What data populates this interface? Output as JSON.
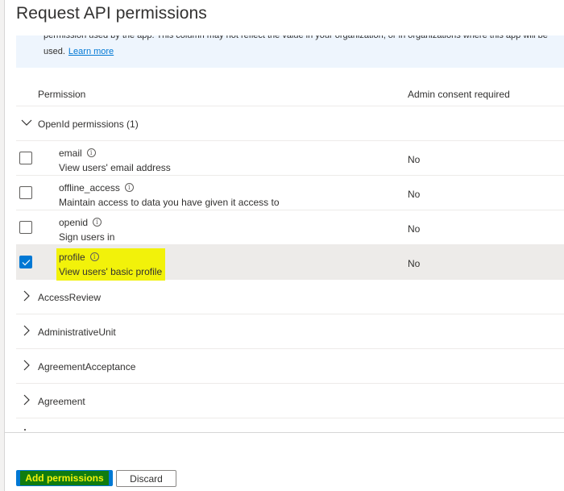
{
  "panel": {
    "title": "Request API permissions"
  },
  "info_banner": {
    "line1": "permission used by the app. This column may not reflect the value in your organization, or in organizations where this app will be",
    "line2": "used.",
    "link": "Learn more"
  },
  "table": {
    "headers": {
      "permission": "Permission",
      "admin_consent": "Admin consent required"
    },
    "expanded_group": {
      "label": "OpenId permissions (1)",
      "icon": "chevron-down-icon",
      "permissions": [
        {
          "name": "email",
          "description": "View users' email address",
          "admin_consent": "No",
          "checked": false,
          "highlighted": false
        },
        {
          "name": "offline_access",
          "description": "Maintain access to data you have given it access to",
          "admin_consent": "No",
          "checked": false,
          "highlighted": false
        },
        {
          "name": "openid",
          "description": "Sign users in",
          "admin_consent": "No",
          "checked": false,
          "highlighted": false
        },
        {
          "name": "profile",
          "description": "View users' basic profile",
          "admin_consent": "No",
          "checked": true,
          "highlighted": true
        }
      ]
    },
    "collapsed_groups": [
      {
        "label": "AccessReview",
        "icon": "chevron-right-icon"
      },
      {
        "label": "AdministrativeUnit",
        "icon": "chevron-right-icon"
      },
      {
        "label": "AgreementAcceptance",
        "icon": "chevron-right-icon"
      },
      {
        "label": "Agreement",
        "icon": "chevron-right-icon"
      }
    ]
  },
  "footer": {
    "add_permissions_label": "Add permissions",
    "discard_label": "Discard"
  },
  "colors": {
    "accent": "#0078d4",
    "highlight_yellow": "#f2f20a",
    "highlight_green": "#107c10",
    "selected_row": "#edebe9",
    "banner_bg": "#eef5fd"
  }
}
